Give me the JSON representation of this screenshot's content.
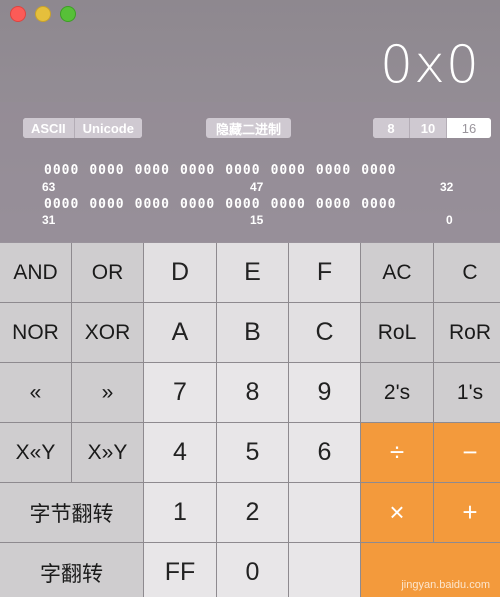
{
  "display": {
    "value": "0x0"
  },
  "modes": [
    "ASCII",
    "Unicode"
  ],
  "hide_binary_label": "隐藏二进制",
  "bases": [
    "8",
    "10",
    "16"
  ],
  "bits": {
    "row1": [
      "0000",
      "0000",
      "0000",
      "0000",
      "0000",
      "0000",
      "0000",
      "0000"
    ],
    "row2": [
      "0000",
      "0000",
      "0000",
      "0000",
      "0000",
      "0000",
      "0000",
      "0000"
    ],
    "row1_labels": [
      "63",
      "47",
      "32"
    ],
    "row2_labels": [
      "31",
      "15",
      "0"
    ]
  },
  "keys": {
    "and": "AND",
    "or": "OR",
    "d": "D",
    "e": "E",
    "f": "F",
    "ac": "AC",
    "c_clear": "C",
    "nor": "NOR",
    "xor": "XOR",
    "a": "A",
    "b": "B",
    "c": "C",
    "rol": "RoL",
    "ror": "RoR",
    "shl": "«",
    "shr": "»",
    "n7": "7",
    "n8": "8",
    "n9": "9",
    "twos": "2's",
    "ones": "1's",
    "xshly": "X«Y",
    "xshry": "X»Y",
    "n4": "4",
    "n5": "5",
    "n6": "6",
    "divide": "÷",
    "minus": "−",
    "byte_flip": "字节翻转",
    "n1": "1",
    "n2": "2",
    "multiply": "×",
    "plus": "+",
    "word_flip": "字翻转",
    "ff": "FF",
    "n0": "0"
  },
  "watermark": "jingyan.baidu.com",
  "colors": {
    "operator": "#f39a3c",
    "accent_active": "#ffffff"
  }
}
